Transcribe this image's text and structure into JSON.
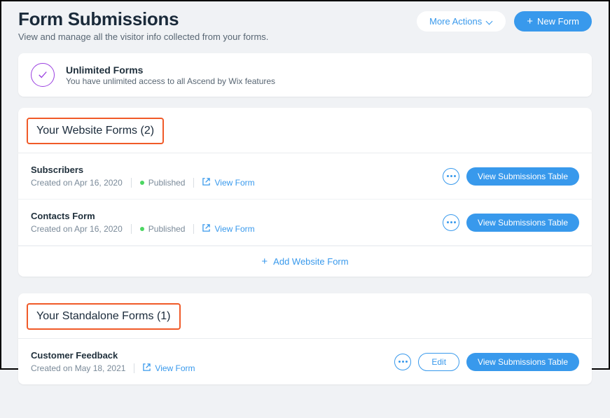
{
  "header": {
    "title": "Form Submissions",
    "subtitle": "View and manage all the visitor info collected from your forms.",
    "more_actions": "More Actions",
    "new_form": "New Form"
  },
  "banner": {
    "title": "Unlimited Forms",
    "subtitle": "You have unlimited access to all Ascend by Wix features"
  },
  "website_section": {
    "title": "Your Website Forms (2)",
    "add_label": "Add Website Form",
    "forms": [
      {
        "name": "Subscribers",
        "created": "Created on Apr 16, 2020",
        "status": "Published",
        "view_form": "View Form",
        "view_table": "View Submissions Table"
      },
      {
        "name": "Contacts Form",
        "created": "Created on Apr 16, 2020",
        "status": "Published",
        "view_form": "View Form",
        "view_table": "View Submissions Table"
      }
    ]
  },
  "standalone_section": {
    "title": "Your Standalone Forms (1)",
    "forms": [
      {
        "name": "Customer Feedback",
        "created": "Created on May 18, 2021",
        "view_form": "View Form",
        "edit": "Edit",
        "view_table": "View Submissions Table"
      }
    ]
  }
}
